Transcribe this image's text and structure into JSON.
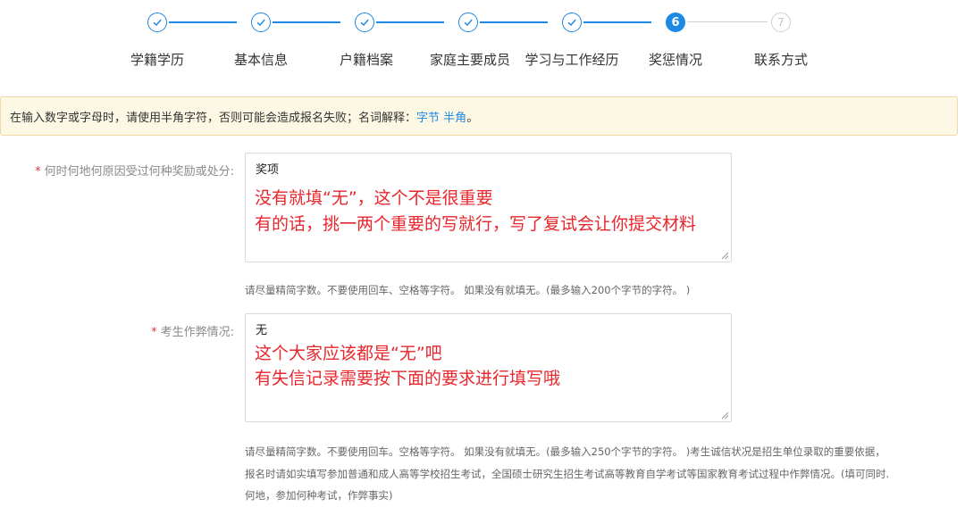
{
  "stepper": {
    "steps": [
      {
        "label": "学籍学历",
        "state": "done"
      },
      {
        "label": "基本信息",
        "state": "done"
      },
      {
        "label": "户籍档案",
        "state": "done"
      },
      {
        "label": "家庭主要成员",
        "state": "done"
      },
      {
        "label": "学习与工作经历",
        "state": "done"
      },
      {
        "label": "奖惩情况",
        "state": "active",
        "number": "6"
      },
      {
        "label": "联系方式",
        "state": "todo",
        "number": "7"
      }
    ]
  },
  "notice": {
    "text": "在输入数字或字母时，请使用半角字符，否则可能会造成报名失败；名词解释：",
    "link_bytes": "字节",
    "link_halfwidth": "半角",
    "suffix": "。"
  },
  "form": {
    "required_mark": "*",
    "rewards": {
      "label": "何时何地何原因受过何种奖励或处分:",
      "value": "奖项",
      "annotation_line1": "没有就填“无”，这个不是很重要",
      "annotation_line2": "有的话，挑一两个重要的写就行，写了复试会让你提交材料",
      "hint": "请尽量精简字数。不要使用回车、空格等字符。 如果没有就填无。(最多输入200个字节的字符。 )"
    },
    "cheating": {
      "label": "考生作弊情况:",
      "value": "无",
      "annotation_line1": "这个大家应该都是“无”吧",
      "annotation_line2": "有失信记录需要按下面的要求进行填写哦",
      "hint_line1": "请尽量精简字数。不要使用回车。空格等字符。 如果没有就填无。(最多输入250个字节的字符。 )考生诚信状况是招生单位录取的重要依据，",
      "hint_line2": "报名时请如实填写参加普通和成人高等学校招生考试，全国硕士研究生招生考试高等教育自学考试等国家教育考试过程中作弊情况。(填可同时.",
      "hint_line3": "何地，参加何种考试，作弊事实)"
    }
  },
  "colors": {
    "accent": "#1e88e5",
    "annotation": "#e8262c",
    "required": "#e5383b",
    "notice_bg": "#fcf8e3"
  },
  "icons": {
    "done_step": "check-circle-icon",
    "resize": "resize-grip-icon"
  }
}
